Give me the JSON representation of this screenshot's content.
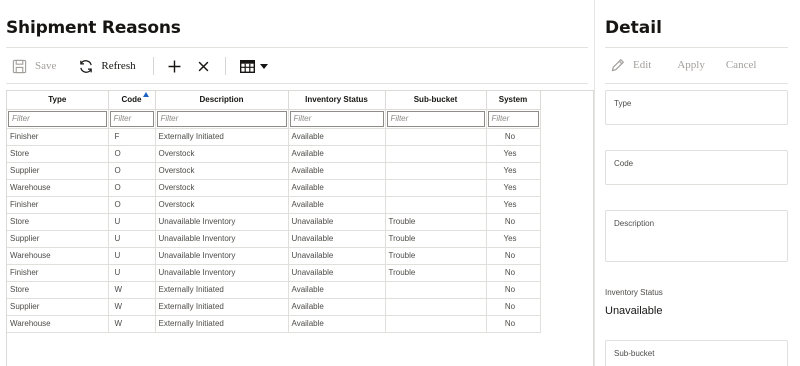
{
  "list": {
    "title": "Shipment Reasons",
    "toolbar": {
      "save_label": "Save",
      "refresh_label": "Refresh",
      "add_icon": "plus-icon",
      "delete_icon": "close-icon",
      "view_icon": "table-view-icon"
    },
    "columns": [
      "Type",
      "Code",
      "Description",
      "Inventory Status",
      "Sub-bucket",
      "System"
    ],
    "sorted_column": "Code",
    "filter_placeholder": "Filter",
    "rows": [
      {
        "type": "Finisher",
        "code": "F",
        "description": "Externally Initiated",
        "inventory_status": "Available",
        "sub_bucket": "",
        "system": "No"
      },
      {
        "type": "Store",
        "code": "O",
        "description": "Overstock",
        "inventory_status": "Available",
        "sub_bucket": "",
        "system": "Yes"
      },
      {
        "type": "Supplier",
        "code": "O",
        "description": "Overstock",
        "inventory_status": "Available",
        "sub_bucket": "",
        "system": "Yes"
      },
      {
        "type": "Warehouse",
        "code": "O",
        "description": "Overstock",
        "inventory_status": "Available",
        "sub_bucket": "",
        "system": "Yes"
      },
      {
        "type": "Finisher",
        "code": "O",
        "description": "Overstock",
        "inventory_status": "Available",
        "sub_bucket": "",
        "system": "Yes"
      },
      {
        "type": "Store",
        "code": "U",
        "description": "Unavailable Inventory",
        "inventory_status": "Unavailable",
        "sub_bucket": "Trouble",
        "system": "No"
      },
      {
        "type": "Supplier",
        "code": "U",
        "description": "Unavailable Inventory",
        "inventory_status": "Unavailable",
        "sub_bucket": "Trouble",
        "system": "Yes"
      },
      {
        "type": "Warehouse",
        "code": "U",
        "description": "Unavailable Inventory",
        "inventory_status": "Unavailable",
        "sub_bucket": "Trouble",
        "system": "No"
      },
      {
        "type": "Finisher",
        "code": "U",
        "description": "Unavailable Inventory",
        "inventory_status": "Unavailable",
        "sub_bucket": "Trouble",
        "system": "No"
      },
      {
        "type": "Store",
        "code": "W",
        "description": "Externally Initiated",
        "inventory_status": "Available",
        "sub_bucket": "",
        "system": "No"
      },
      {
        "type": "Supplier",
        "code": "W",
        "description": "Externally Initiated",
        "inventory_status": "Available",
        "sub_bucket": "",
        "system": "No"
      },
      {
        "type": "Warehouse",
        "code": "W",
        "description": "Externally Initiated",
        "inventory_status": "Available",
        "sub_bucket": "",
        "system": "No"
      }
    ]
  },
  "detail": {
    "title": "Detail",
    "edit_label": "Edit",
    "apply_label": "Apply",
    "cancel_label": "Cancel",
    "type_label": "Type",
    "code_label": "Code",
    "description_label": "Description",
    "inventory_status_label": "Inventory Status",
    "inventory_status_value": "Unavailable",
    "sub_bucket_label": "Sub-bucket"
  },
  "colors": {
    "accent": "#1d62c3",
    "disabled_text": "#a29f9b",
    "border": "#e1dfdc"
  }
}
